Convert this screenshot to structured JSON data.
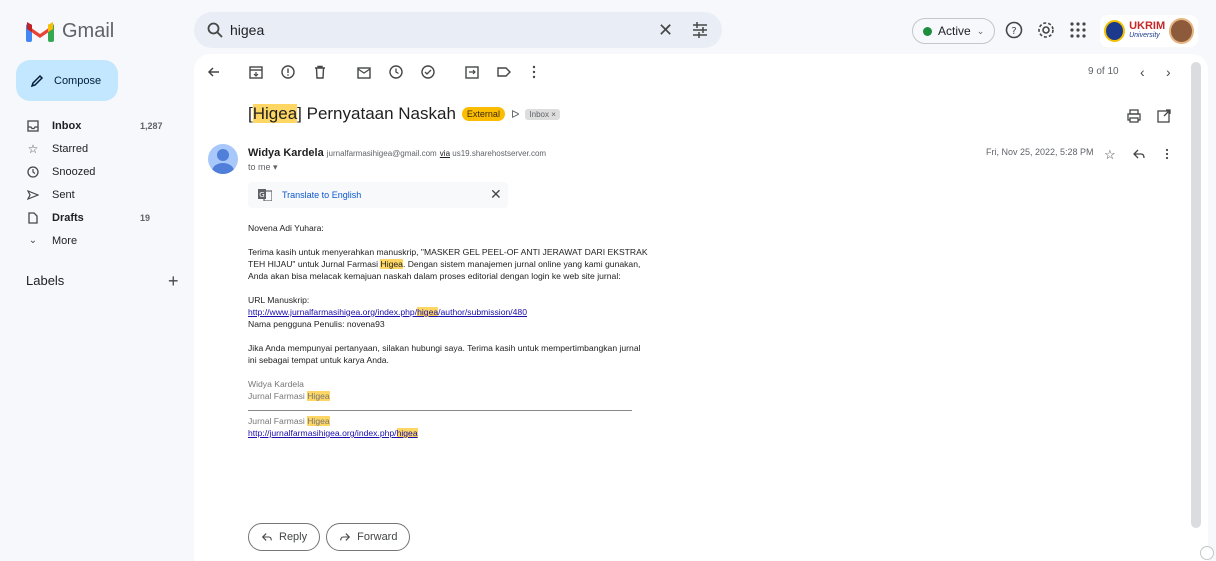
{
  "app": {
    "name": "Gmail"
  },
  "search": {
    "query": "higea"
  },
  "header": {
    "status": "Active"
  },
  "sidebar": {
    "compose_label": "Compose",
    "items": [
      {
        "label": "Inbox",
        "count": "1,287",
        "bold": true,
        "icon": "inbox-icon"
      },
      {
        "label": "Starred",
        "count": "",
        "bold": false,
        "icon": "star-icon"
      },
      {
        "label": "Snoozed",
        "count": "",
        "bold": false,
        "icon": "clock-icon"
      },
      {
        "label": "Sent",
        "count": "",
        "bold": false,
        "icon": "send-icon"
      },
      {
        "label": "Drafts",
        "count": "19",
        "bold": true,
        "icon": "file-icon"
      },
      {
        "label": "More",
        "count": "",
        "bold": false,
        "icon": "chevron-down-icon"
      }
    ],
    "labels_title": "Labels"
  },
  "account": {
    "org_name": "UKRIM",
    "org_sub": "University"
  },
  "toolbar": {
    "pager": "9 of 10"
  },
  "email": {
    "subject_prefix_bracket_open": "[",
    "subject_hl": "Higea",
    "subject_rest": "] Pernyataan Naskah",
    "badge_external": "External",
    "badge_inbox": "Inbox ×",
    "sender_name": "Widya Kardela",
    "sender_email": "jurnalfarmasihigea@gmail.com",
    "via_word": "via",
    "via_host": "us19.sharehostserver.com",
    "to_me": "to me ▾",
    "date": "Fri, Nov 25, 2022, 5:28 PM",
    "translate_label": "Translate to English",
    "body": {
      "greeting": "Novena Adi Yuhara:",
      "p1a": "Terima kasih untuk menyerahkan manuskrip, \"MASKER GEL PEEL-OF ANTI JERAWAT DARI EKSTRAK TEH HIJAU\" untuk Jurnal Farmasi ",
      "p1hl": "Higea",
      "p1b": ". Dengan sistem manajemen jurnal online yang kami gunakan, Anda akan bisa melacak kemajuan naskah dalam proses editorial dengan login ke web site jurnal:",
      "url_label": "URL Manuskrip:",
      "url_a": "http://www.jurnalfarmasihigea.org/index.php/",
      "url_hl": "higea",
      "url_b": "/author/submission/480",
      "username_line": "Nama pengguna Penulis: novena93",
      "p3": "Jika Anda mempunyai pertanyaan, silakan hubungi saya. Terima kasih untuk mempertimbangkan jurnal ini sebagai tempat untuk karya Anda.",
      "sig_name": "Widya Kardela",
      "sig_journal_a": "Jurnal Farmasi ",
      "sig_journal_hl": "Higea",
      "footer_journal_a": "Jurnal Farmasi ",
      "footer_journal_hl": "Higea",
      "footer_url_a": "http://jurnalfarmasihigea.org/index.php/",
      "footer_url_hl": "higea"
    },
    "reply_label": "Reply",
    "forward_label": "Forward"
  },
  "colors": {
    "compose_bg": "#c2e7ff",
    "search_bg": "#e9eef6",
    "highlight": "#fdd663",
    "external_badge": "#fbbc04",
    "active_dot": "#1e8e3e",
    "link": "#0b57d0"
  }
}
